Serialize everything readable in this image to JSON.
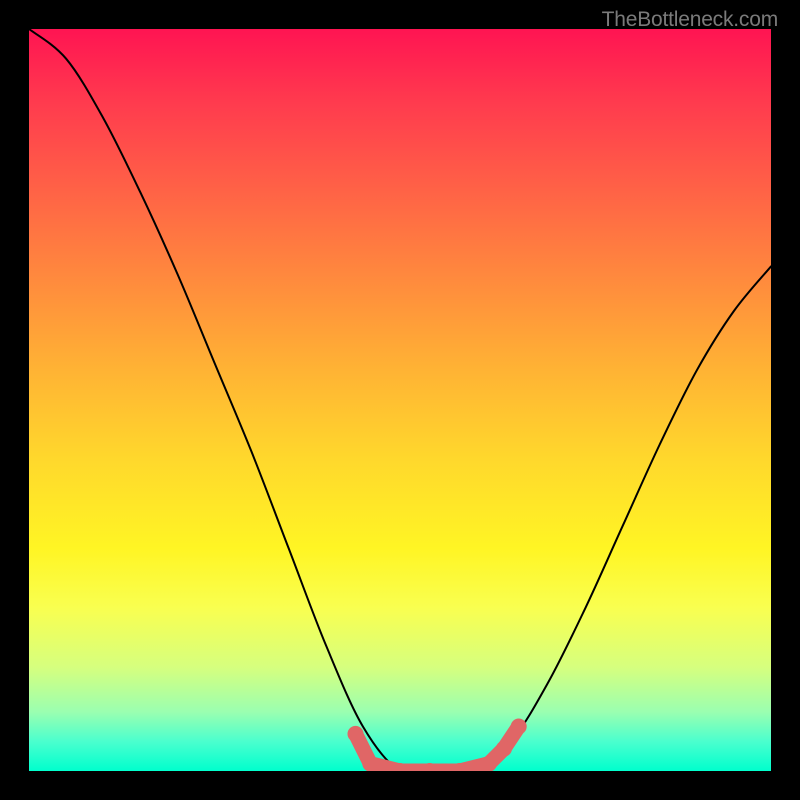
{
  "watermark": "TheBottleneck.com",
  "chart_data": {
    "type": "line",
    "title": "",
    "xlabel": "",
    "ylabel": "",
    "x": [
      0.0,
      0.05,
      0.1,
      0.15,
      0.2,
      0.25,
      0.3,
      0.35,
      0.4,
      0.45,
      0.5,
      0.55,
      0.6,
      0.65,
      0.7,
      0.75,
      0.8,
      0.85,
      0.9,
      0.95,
      1.0
    ],
    "values": [
      100,
      96,
      88,
      78,
      67,
      55,
      43,
      30,
      17,
      6,
      0,
      0,
      0,
      4,
      12,
      22,
      33,
      44,
      54,
      62,
      68
    ],
    "ylim": [
      0,
      100
    ],
    "xlim": [
      0,
      1
    ],
    "markers": [
      {
        "x": 0.44,
        "y": 5
      },
      {
        "x": 0.46,
        "y": 1
      },
      {
        "x": 0.5,
        "y": 0
      },
      {
        "x": 0.54,
        "y": 0
      },
      {
        "x": 0.58,
        "y": 0
      },
      {
        "x": 0.62,
        "y": 1
      },
      {
        "x": 0.64,
        "y": 3
      },
      {
        "x": 0.66,
        "y": 6
      }
    ],
    "marker_color": "#e06666",
    "curve_color": "#000000",
    "background": "gradient-red-yellow-green"
  }
}
